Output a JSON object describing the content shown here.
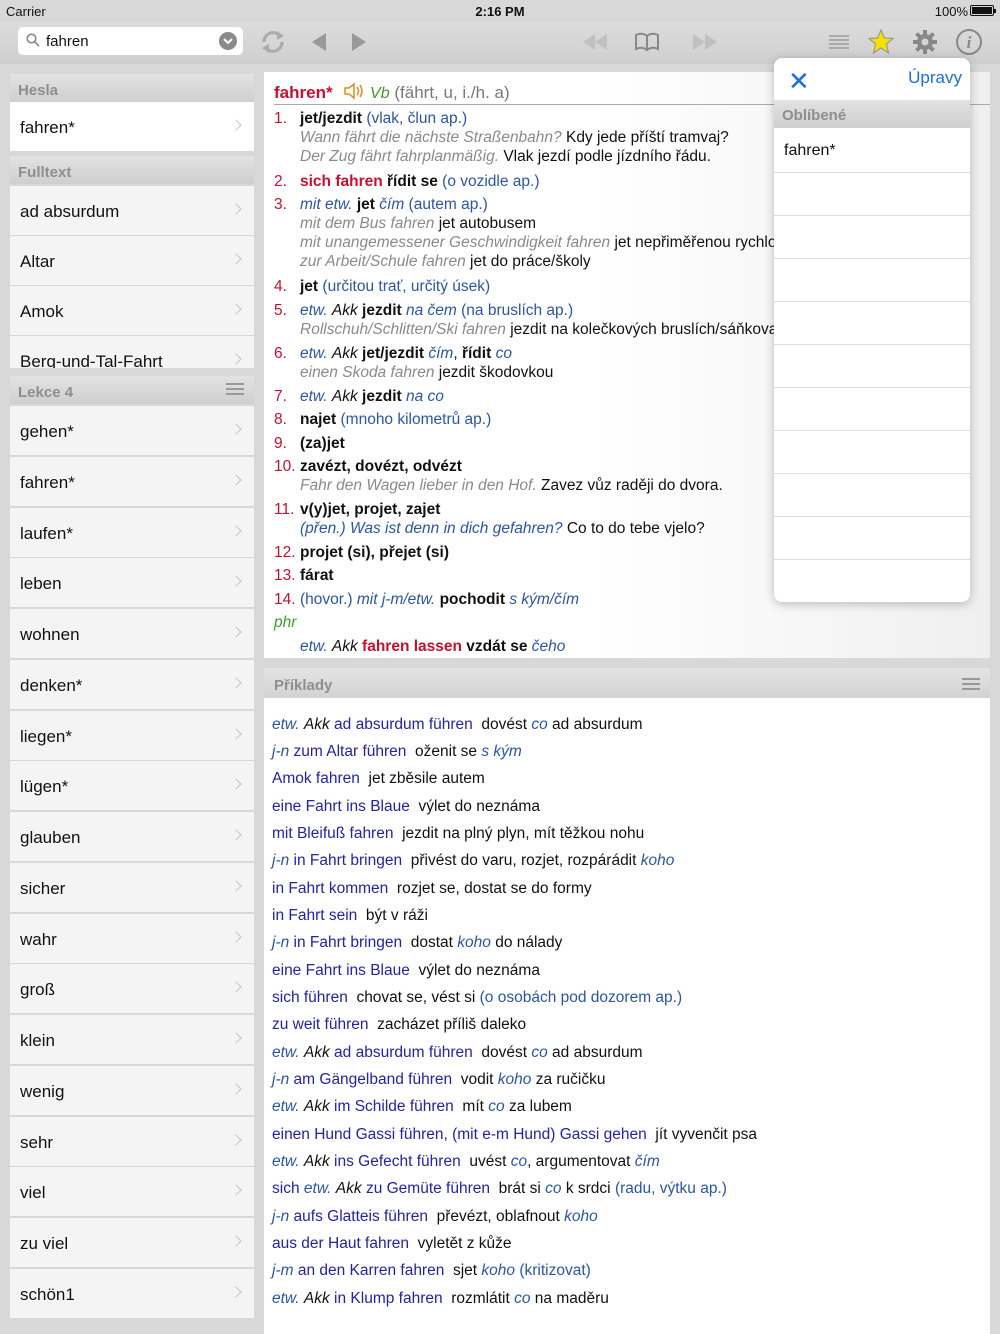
{
  "status": {
    "carrier": "Carrier",
    "time": "2:16 PM",
    "battery": "100%"
  },
  "search": {
    "value": "fahren"
  },
  "left": {
    "section_hesla": "Hesla",
    "hesla": [
      "fahren*"
    ],
    "section_fulltext": "Fulltext",
    "fulltext": [
      "ad absurdum",
      "Altar",
      "Amok",
      "Berg-und-Tal-Fahrt"
    ],
    "section_lekce": "Lekce 4",
    "lekce": [
      "gehen*",
      "fahren*",
      "laufen*",
      "leben",
      "wohnen",
      "denken*",
      "liegen*",
      "lügen*",
      "glauben",
      "sicher",
      "wahr",
      "groß",
      "klein",
      "wenig",
      "sehr",
      "viel",
      "zu viel",
      "schön1"
    ]
  },
  "entry": {
    "headword": "fahren*",
    "pos": "Vb",
    "forms": "(fährt, u, i./h. a)"
  },
  "examples_title": "Příklady",
  "popover": {
    "close": "✕",
    "edit": "Úpravy",
    "section": "Oblíbené",
    "items": [
      "fahren*"
    ]
  }
}
